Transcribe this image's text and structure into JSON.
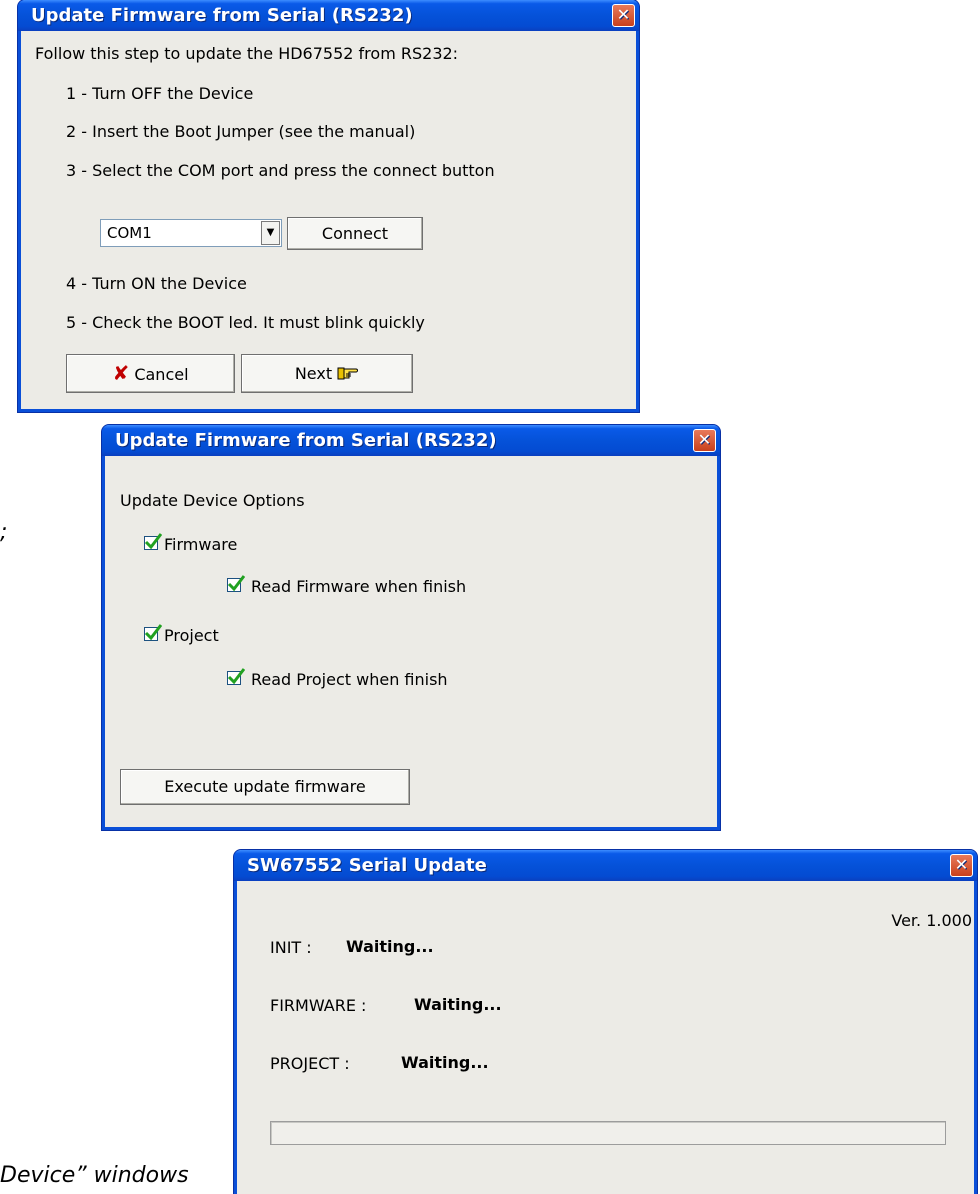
{
  "window1": {
    "title": "Update Firmware from Serial (RS232)",
    "close_label": "✕",
    "intro": "Follow this step to update the HD67552 from RS232:",
    "step1": "1 - Turn OFF the Device",
    "step2": "2 - Insert the Boot Jumper (see the manual)",
    "step3": "3 - Select the  COM port and press the connect button",
    "com_port_value": "COM1",
    "connect_label": "Connect",
    "step4": "4 - Turn ON the Device",
    "step5": "5 - Check the BOOT led. It must blink quickly",
    "cancel_label": "Cancel",
    "next_label": "Next"
  },
  "window2": {
    "title": "Update Firmware from Serial (RS232)",
    "close_label": "✕",
    "heading": "Update Device Options",
    "firmware_label": "Firmware",
    "firmware_checked": true,
    "read_firmware_label": "Read Firmware when finish",
    "read_firmware_checked": true,
    "project_label": "Project",
    "project_checked": true,
    "read_project_label": "Read Project when finish",
    "read_project_checked": true,
    "execute_label": "Execute update firmware"
  },
  "window3": {
    "title": "SW67552 Serial Update",
    "close_label": "✕",
    "version": "Ver. 1.000",
    "init_label": "INIT :",
    "init_status": "Waiting...",
    "firmware_label": "FIRMWARE :",
    "firmware_status": "Waiting...",
    "project_label": "PROJECT :",
    "project_status": "Waiting...",
    "progress": 0
  },
  "page_text": {
    "semicolon": ";",
    "caption_fragment": "Device” windows"
  },
  "colors": {
    "titlebar_blue": "#0552d9",
    "window_bg": "#ecebe6",
    "check_green": "#21a121",
    "cancel_red": "#c00000"
  }
}
